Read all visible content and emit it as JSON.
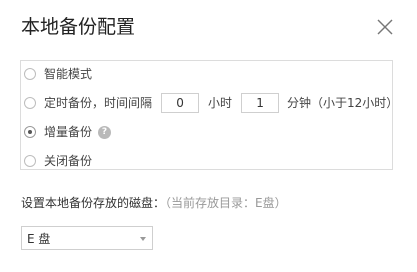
{
  "dialog": {
    "title": "本地备份配置"
  },
  "backup_mode": {
    "options": [
      {
        "label": "智能模式",
        "checked": false
      },
      {
        "label": "定时备份，时间间隔",
        "checked": false
      },
      {
        "label": "增量备份",
        "checked": true
      },
      {
        "label": "关闭备份",
        "checked": false
      }
    ],
    "schedule": {
      "hours_value": "0",
      "hours_unit": "小时",
      "minutes_value": "1",
      "minutes_unit": "分钟（小于12小时）"
    },
    "help_icon": "question-icon",
    "help_glyph": "?"
  },
  "disk": {
    "label": "设置本地备份存放的磁盘：",
    "hint": "（当前存放目录：E盘）",
    "selected": "E 盘"
  },
  "icons": {
    "close": "close-icon",
    "caret": "caret-down-icon"
  },
  "colors": {
    "border": "#dcdcdc",
    "text": "#333333",
    "hint": "#999999",
    "help_icon_bg": "#b9b9b9"
  }
}
